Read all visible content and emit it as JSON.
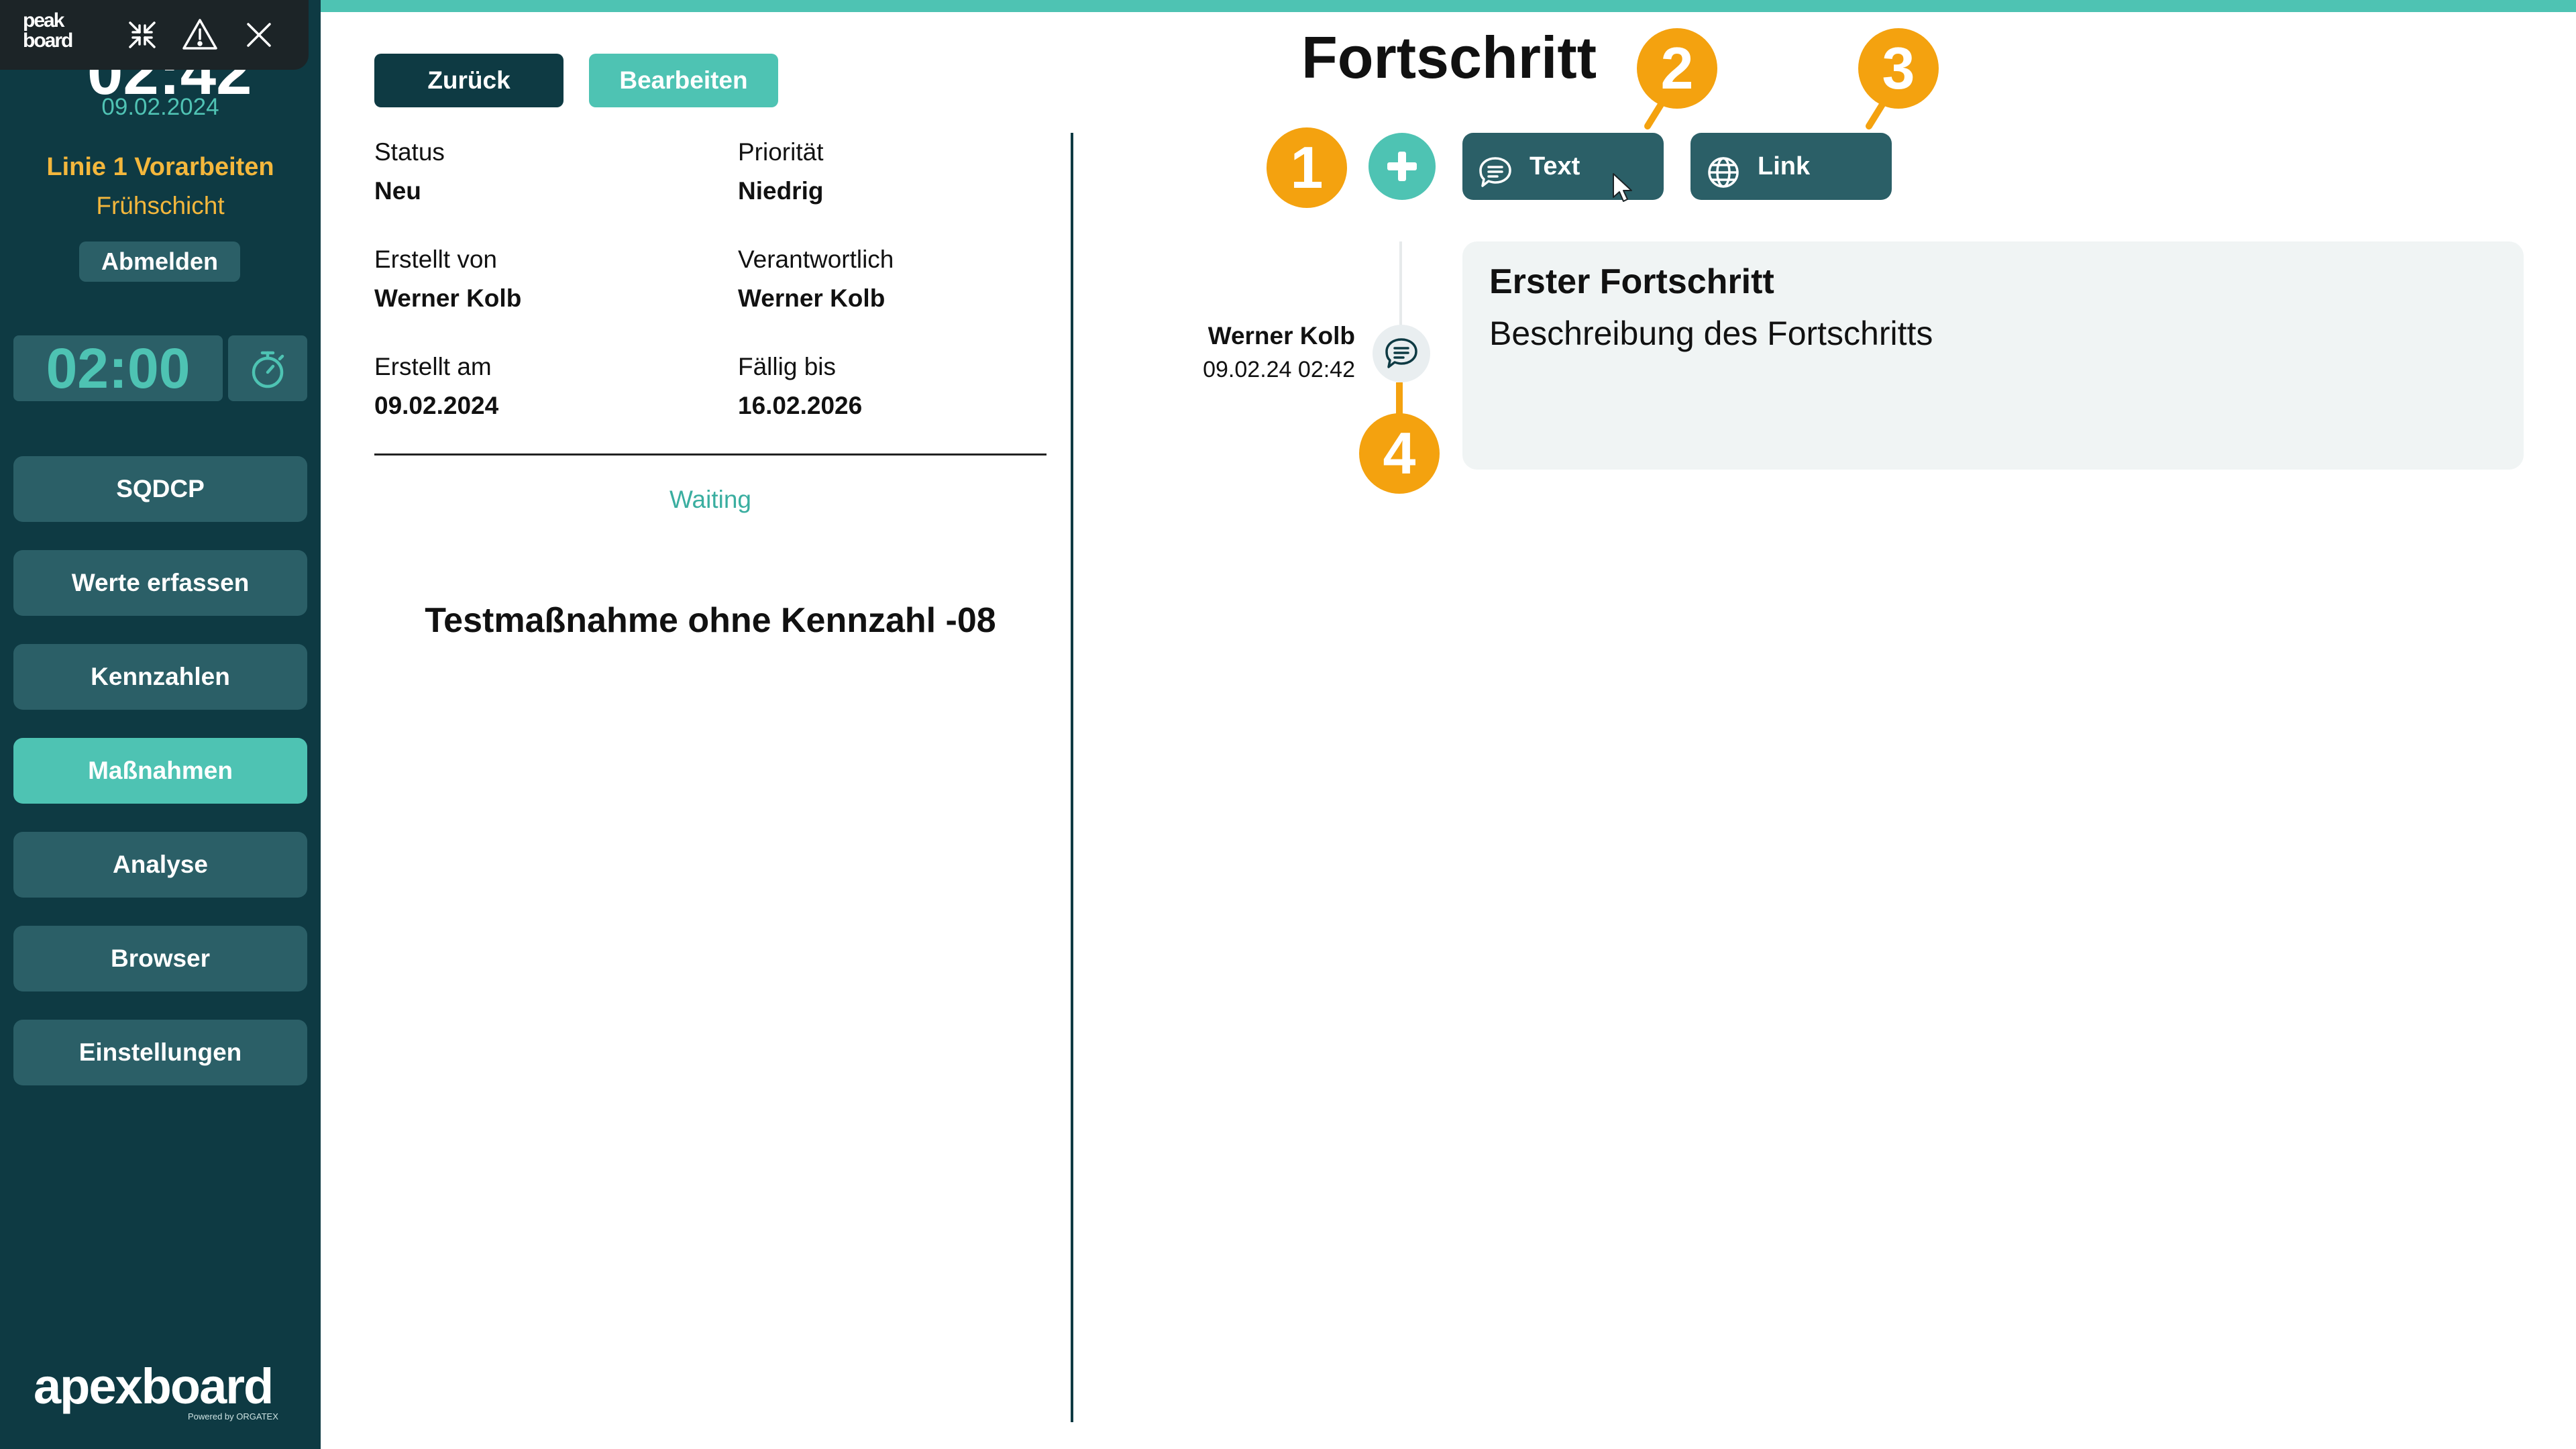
{
  "sidebar": {
    "brand": "peak board",
    "clock_partial": "02:42",
    "date": "09.02.2024",
    "line": "Linie 1 Vorarbeiten",
    "shift": "Frühschicht",
    "logout_label": "Abmelden",
    "timer": "02:00",
    "nav": [
      "SQDCP",
      "Werte erfassen",
      "Kennzahlen",
      "Maßnahmen",
      "Analyse",
      "Browser",
      "Einstellungen"
    ],
    "active_nav": "Maßnahmen",
    "footer_logo": "apexboard",
    "footer_sub": "Powered by ORGATEX"
  },
  "actions": {
    "back_label": "Zurück",
    "edit_label": "Bearbeiten"
  },
  "details": {
    "status_label": "Status",
    "status_value": "Neu",
    "priority_label": "Priorität",
    "priority_value": "Niedrig",
    "created_by_label": "Erstellt von",
    "created_by_value": "Werner Kolb",
    "responsible_label": "Verantwortlich",
    "responsible_value": "Werner Kolb",
    "created_at_label": "Erstellt am",
    "created_at_value": "09.02.2024",
    "due_label": "Fällig bis",
    "due_value": "16.02.2026",
    "state_text": "Waiting",
    "measure_title": "Testmaßnahme ohne Kennzahl -08"
  },
  "progress": {
    "title": "Fortschritt",
    "text_button": "Text",
    "link_button": "Link",
    "badges": [
      "1",
      "2",
      "3",
      "4"
    ],
    "entries": [
      {
        "author": "Werner Kolb",
        "timestamp": "09.02.24 02:42",
        "title": "Erster Fortschritt",
        "description": "Beschreibung des Fortschritts"
      }
    ]
  },
  "colors": {
    "sidebar_bg": "#0e3a43",
    "button_bg": "#2b5f67",
    "accent": "#4ec3b3",
    "highlight": "#f4b73c",
    "badge": "#f4a20f",
    "card_bg": "#f0f4f4"
  }
}
